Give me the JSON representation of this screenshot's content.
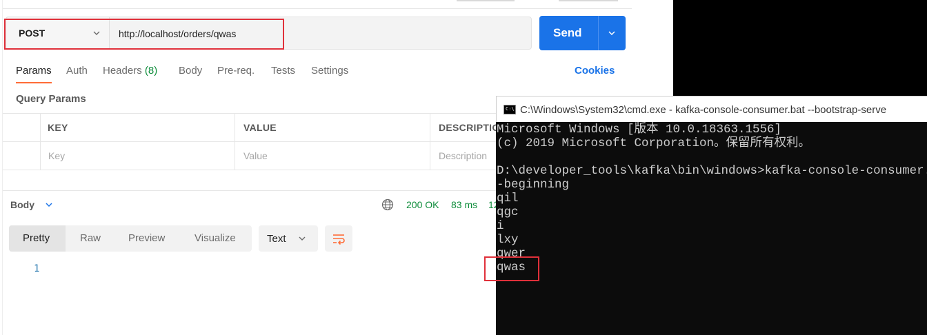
{
  "request": {
    "method": "POST",
    "url": "http://localhost/orders/qwas",
    "send_label": "Send"
  },
  "tabs": [
    {
      "label": "Params"
    },
    {
      "label": "Auth"
    },
    {
      "label": "Headers",
      "count": "(8)"
    },
    {
      "label": "Body"
    },
    {
      "label": "Pre-req."
    },
    {
      "label": "Tests"
    },
    {
      "label": "Settings"
    }
  ],
  "cookies_label": "Cookies",
  "query_params": {
    "title": "Query Params",
    "columns": [
      "KEY",
      "VALUE",
      "DESCRIPTIO"
    ],
    "placeholders": [
      "Key",
      "Value",
      "Description"
    ]
  },
  "response": {
    "body_label": "Body",
    "status": "200 OK",
    "time": "83 ms",
    "size_partial": "12",
    "view_modes": [
      "Pretty",
      "Raw",
      "Preview",
      "Visualize"
    ],
    "format": "Text",
    "line_number": "1"
  },
  "cmd": {
    "title": "C:\\Windows\\System32\\cmd.exe - kafka-console-consumer.bat  --bootstrap-serve",
    "icon_text": "C:\\",
    "lines": [
      "Microsoft Windows [版本 10.0.18363.1556]",
      "(c) 2019 Microsoft Corporation。保留所有权利。",
      "",
      "D:\\developer_tools\\kafka\\bin\\windows>kafka-console-consumer.bat",
      "-beginning",
      "qil",
      "qgc",
      "i",
      "lxy",
      "qwer",
      "qwas"
    ]
  },
  "colors": {
    "accent": "#1a73e8",
    "tab_underline": "#ff6c37",
    "status_green": "#0d8c3a",
    "highlight_red": "#e0303a"
  }
}
